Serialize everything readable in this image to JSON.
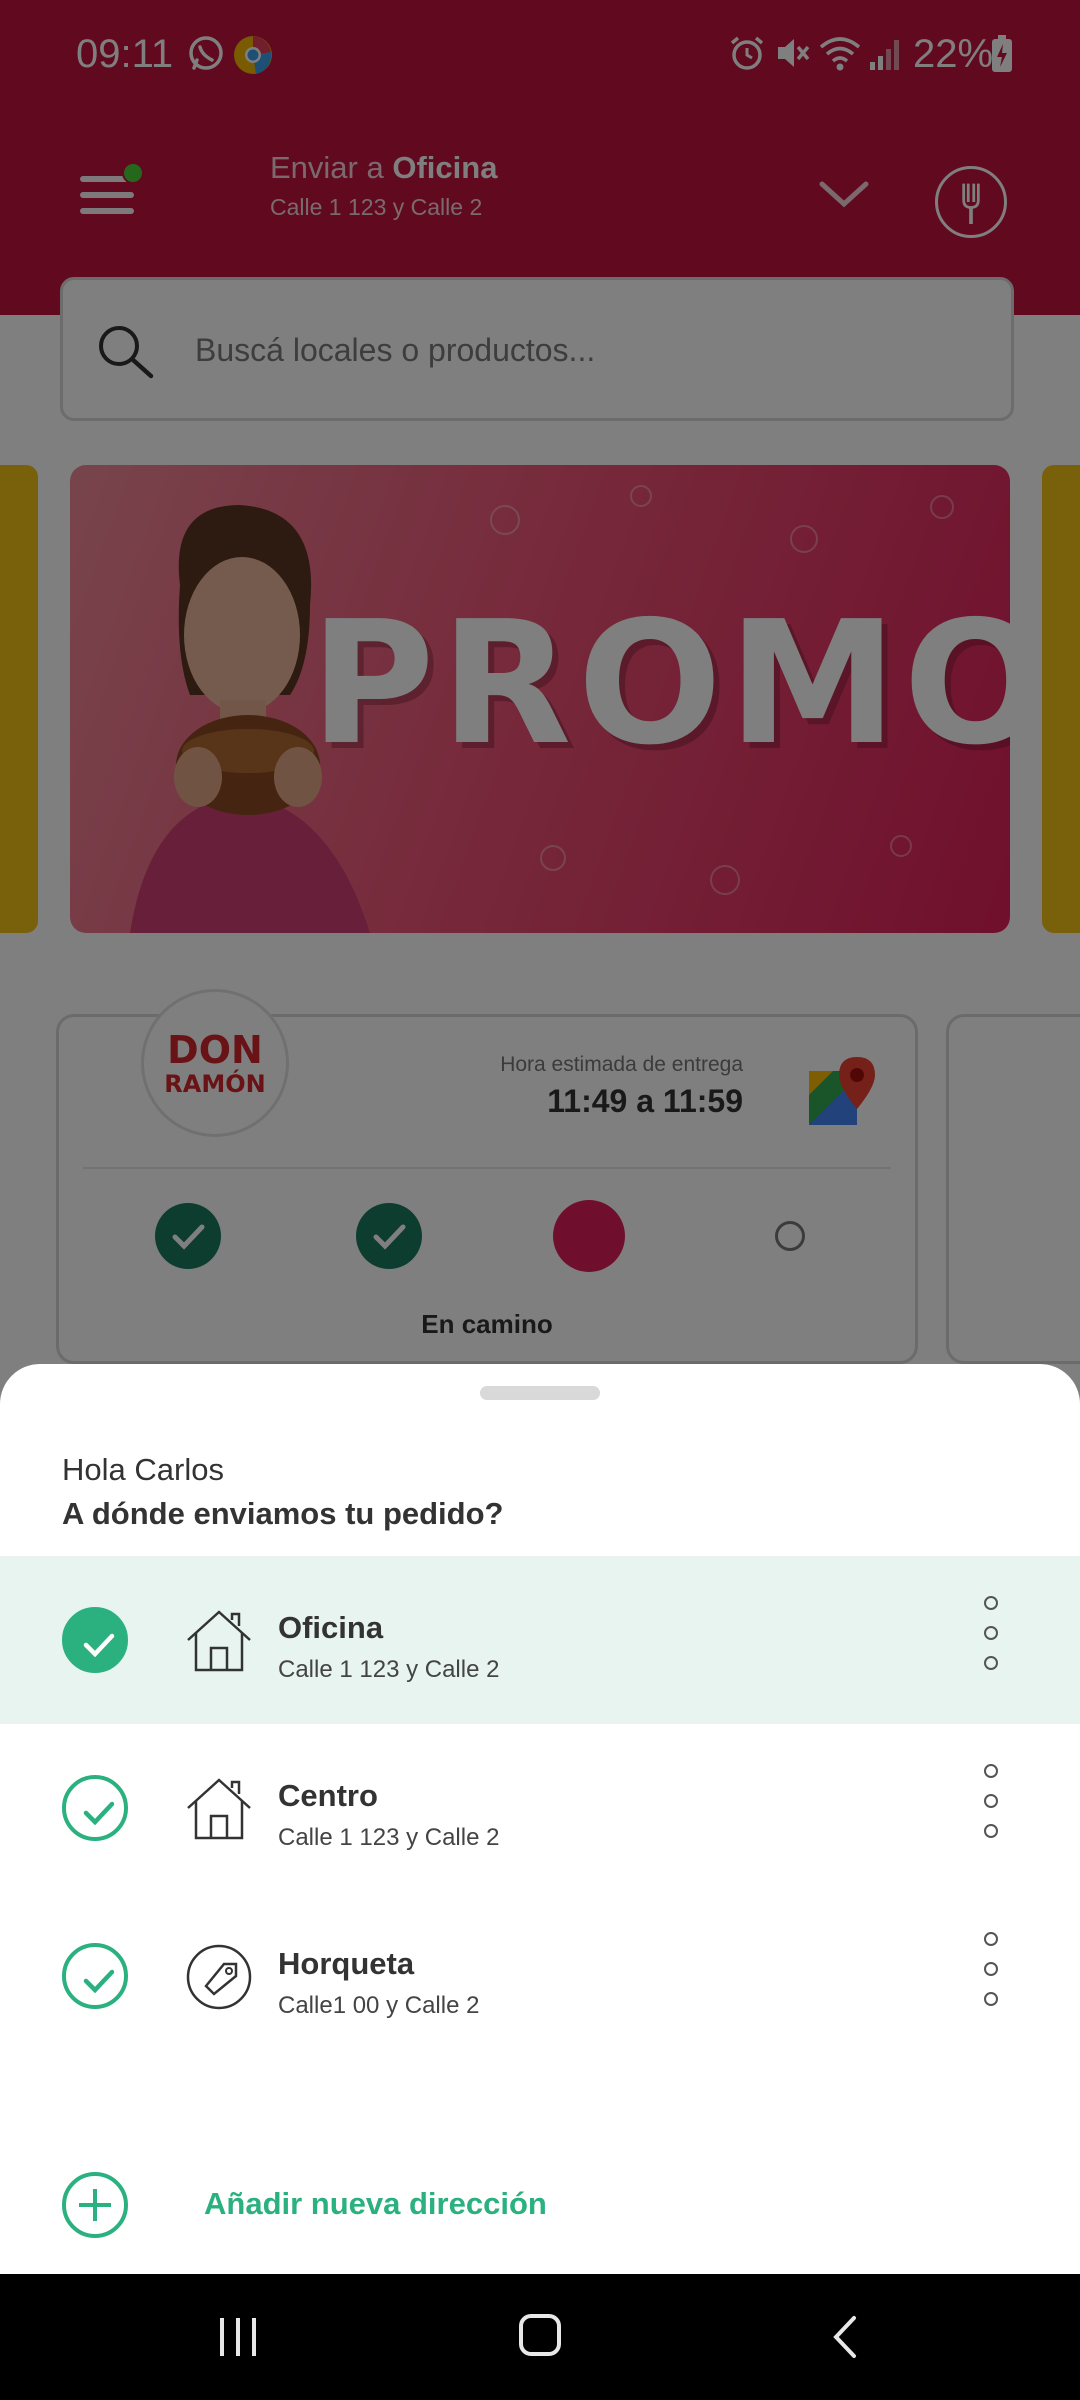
{
  "status_bar": {
    "time": "09:11",
    "battery": "22%",
    "icons": [
      "whatsapp-icon",
      "chrome-icon",
      "alarm-icon",
      "mute-icon",
      "wifi-icon",
      "signal-icon",
      "battery-charging-icon"
    ]
  },
  "header": {
    "deliver_prefix": "Enviar a",
    "deliver_name": "Oficina",
    "deliver_address": "Calle 1 123 y Calle 2",
    "brand_color": "#c2123f"
  },
  "search": {
    "placeholder": "Buscá locales o productos..."
  },
  "promo": {
    "title": "PROMOS"
  },
  "order": {
    "store_logo_line1": "DON",
    "store_logo_line2": "RAMÓN",
    "eta_label": "Hora estimada de entrega",
    "eta_value": "11:49 a 11:59",
    "status": "En camino",
    "steps_completed": 2,
    "steps_total": 4
  },
  "sheet": {
    "greeting": "Hola Carlos",
    "question": "A dónde enviamos tu pedido?",
    "addresses": [
      {
        "name": "Oficina",
        "detail": "Calle 1 123 y Calle 2",
        "icon": "house-icon",
        "selected": true
      },
      {
        "name": "Centro",
        "detail": "Calle 1 123 y Calle 2",
        "icon": "house-icon",
        "selected": false
      },
      {
        "name": "Horqueta",
        "detail": "Calle1 00 y Calle 2",
        "icon": "tag-icon",
        "selected": false
      }
    ],
    "add_label": "Añadir nueva dirección",
    "accent_color": "#2bb07f"
  }
}
